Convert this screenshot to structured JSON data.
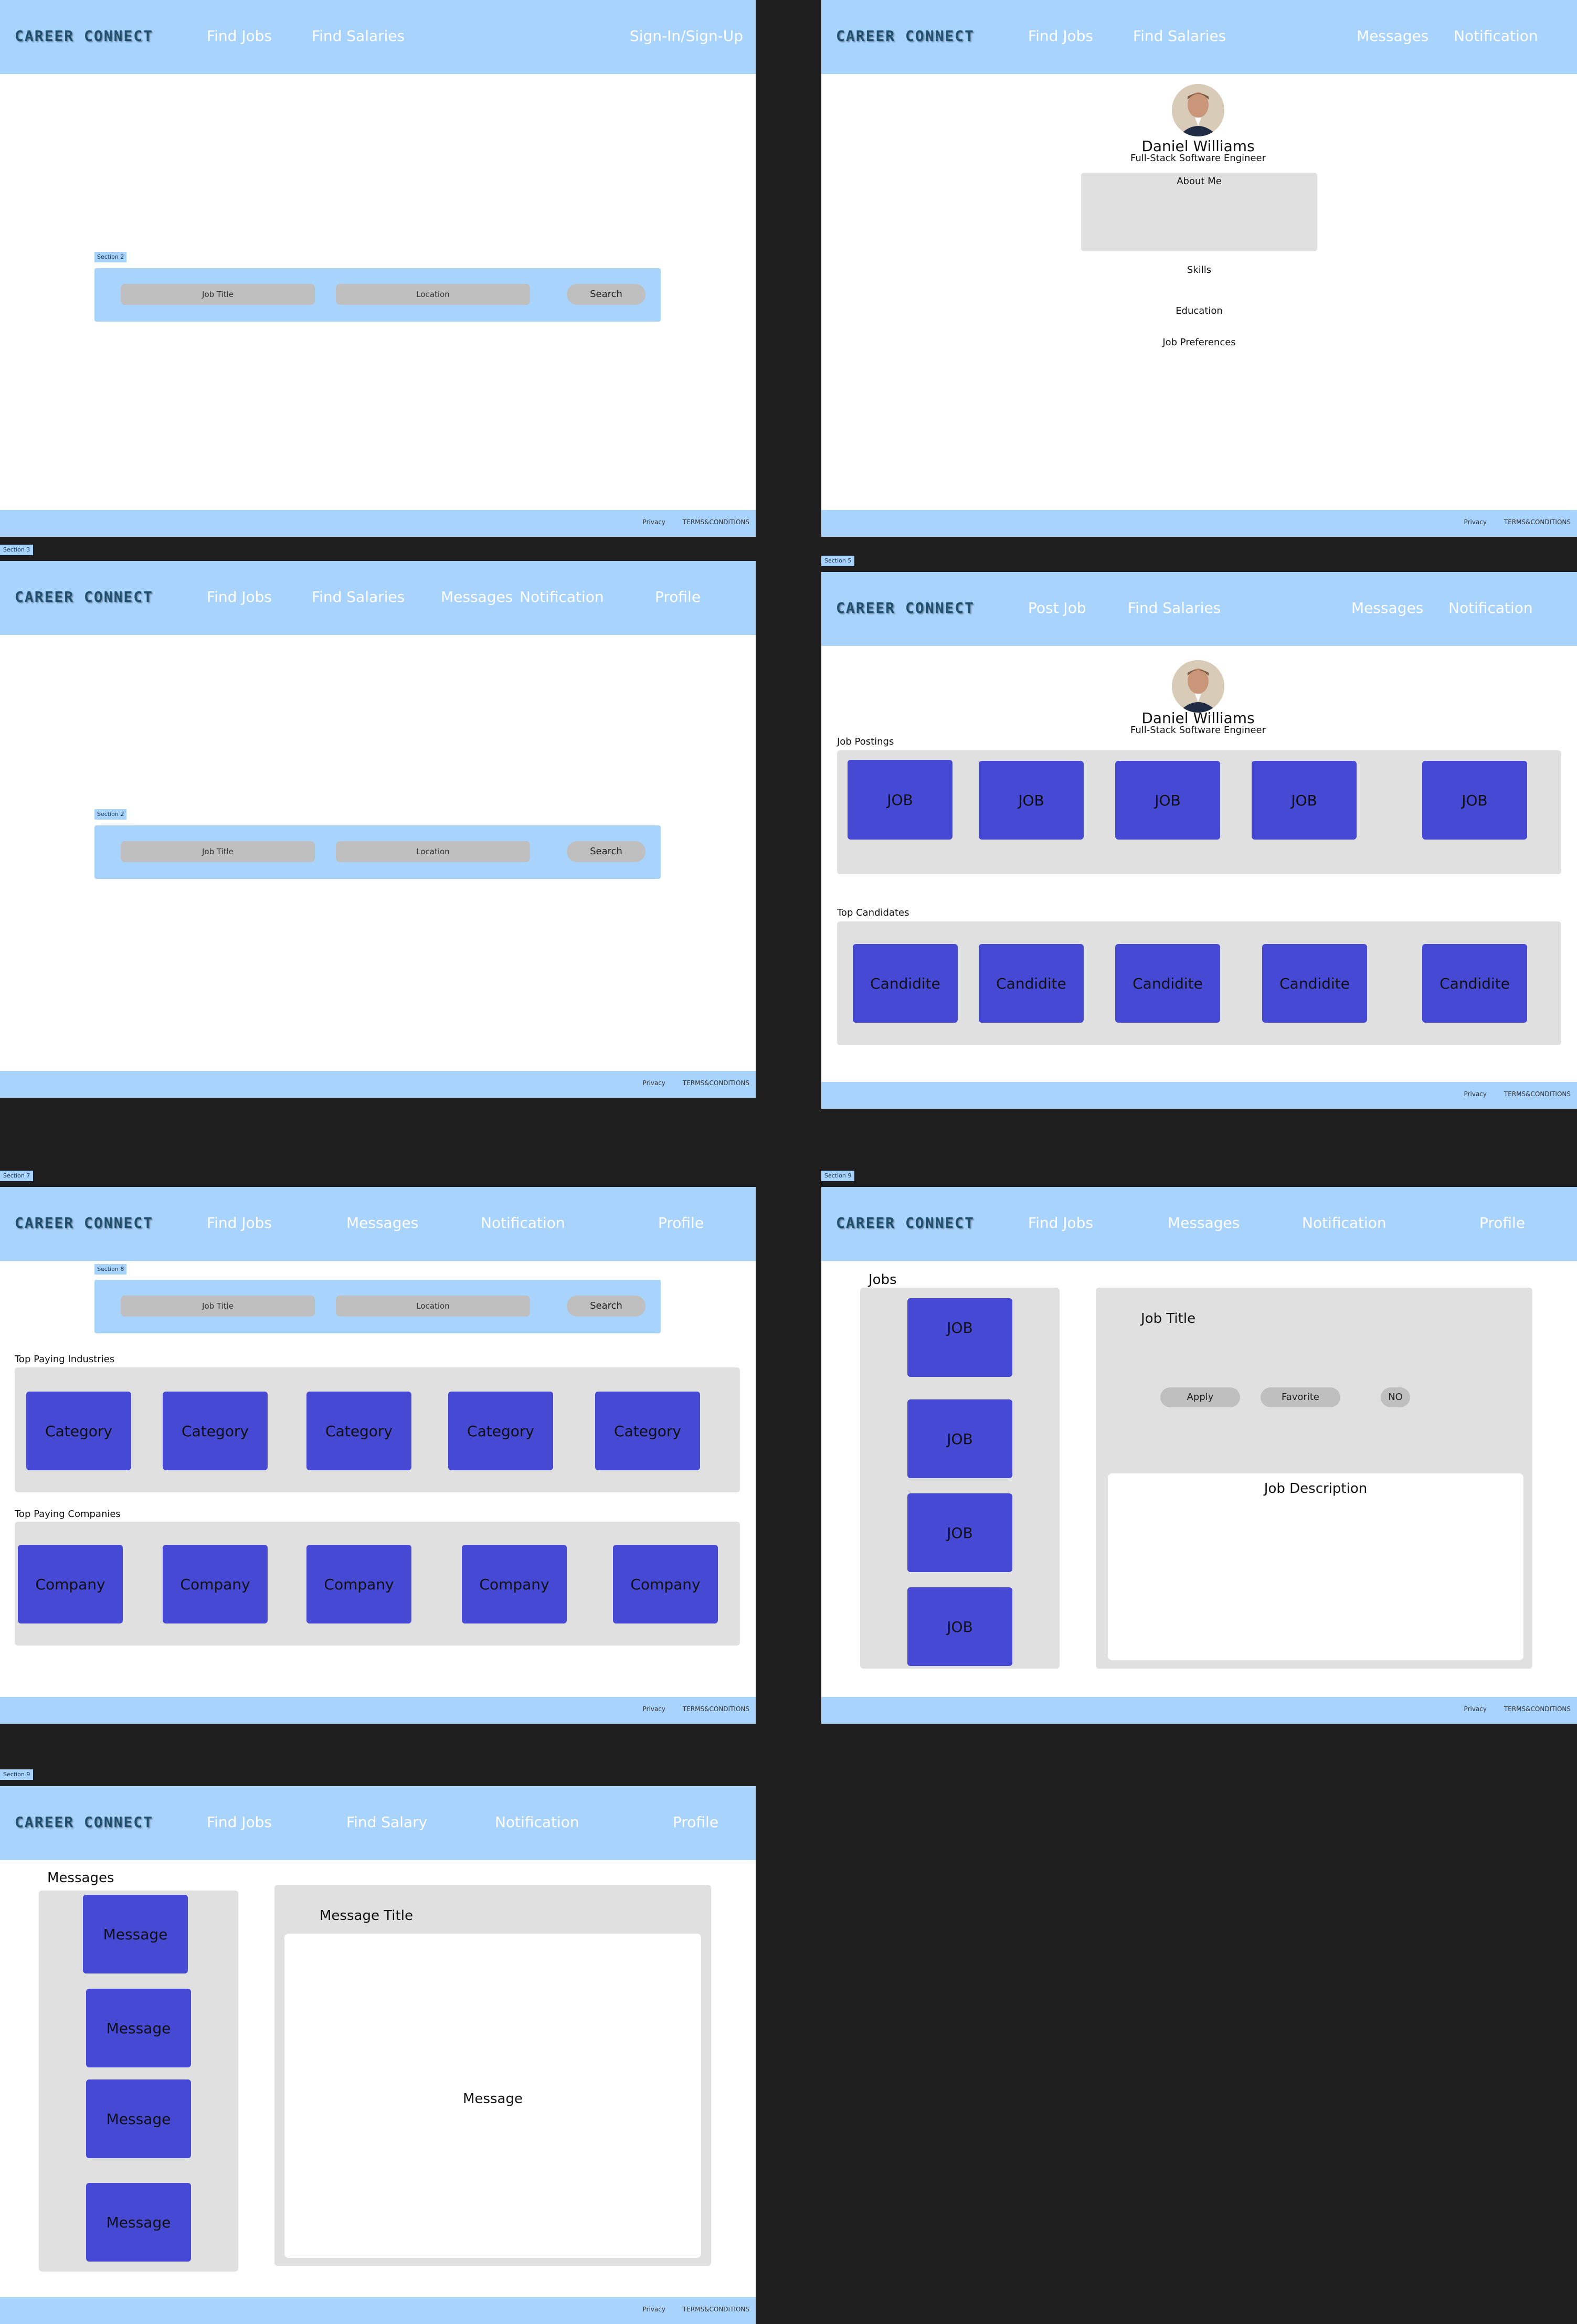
{
  "frames": {
    "f1": {
      "nav": [
        "Find Jobs",
        "Find Salaries",
        "Sign-In/Sign-Up"
      ],
      "section_label": "Section 2",
      "search": {
        "job_title": "Job Title",
        "location": "Location",
        "button": "Search"
      }
    },
    "f2": {
      "nav": [
        "Find Jobs",
        "Find Salaries",
        "Messages",
        "Notification"
      ],
      "profile": {
        "name": "Daniel Williams",
        "role": "Full-Stack Software Engineer"
      },
      "about": "About Me",
      "skills": "Skills",
      "education": "Education",
      "preferences": "Job Preferences"
    },
    "f3": {
      "label": "Section 3",
      "nav": [
        "Find Jobs",
        "Find Salaries",
        "Messages",
        "Notification",
        "Profile"
      ],
      "section_label": "Section 2",
      "search": {
        "job_title": "Job Title",
        "location": "Location",
        "button": "Search"
      }
    },
    "f4": {
      "label": "Section 5",
      "nav": [
        "Post Job",
        "Find Salaries",
        "Messages",
        "Notification"
      ],
      "profile": {
        "name": "Daniel Williams",
        "role": "Full-Stack Software Engineer"
      },
      "postings_title": "Job Postings",
      "postings": [
        "JOB",
        "JOB",
        "JOB",
        "JOB",
        "JOB"
      ],
      "candidates_title": "Top Candidates",
      "candidates": [
        "Candidite",
        "Candidite",
        "Candidite",
        "Candidite",
        "Candidite"
      ]
    },
    "f5": {
      "label": "Section 7",
      "nav": [
        "Find Jobs",
        "Messages",
        "Notification",
        "Profile"
      ],
      "section_label": "Section 8",
      "search": {
        "job_title": "Job Title",
        "location": "Location",
        "button": "Search"
      },
      "industries_title": "Top Paying Industries",
      "industries": [
        "Category",
        "Category",
        "Category",
        "Category",
        "Category"
      ],
      "companies_title": "Top Paying Companies",
      "companies": [
        "Company",
        "Company",
        "Company",
        "Company",
        "Company"
      ]
    },
    "f6": {
      "label": "Section 9",
      "nav": [
        "Find Jobs",
        "Messages",
        "Notification",
        "Profile"
      ],
      "jobs_title": "Jobs",
      "jobs": [
        "JOB",
        "JOB",
        "JOB",
        "JOB"
      ],
      "job_title": "Job Title",
      "apply": "Apply",
      "favorite": "Favorite",
      "no": "NO",
      "description": "Job Description"
    },
    "f7": {
      "label": "Section 9",
      "nav": [
        "Find Jobs",
        "Find Salary",
        "Notification",
        "Profile"
      ],
      "messages_title": "Messages",
      "messages": [
        "Message",
        "Message",
        "Message",
        "Message"
      ],
      "message_title": "Message Title",
      "message_body": "Message"
    }
  },
  "common": {
    "logo": "CAREER CONNECT",
    "footer": {
      "privacy": "Privacy",
      "terms": "TERMS&CONDITIONS"
    }
  },
  "colors": {
    "header": "#a8d3fc",
    "tile": "#4549d4",
    "panel": "#e0e0e0",
    "background": "#1e1e1e"
  }
}
